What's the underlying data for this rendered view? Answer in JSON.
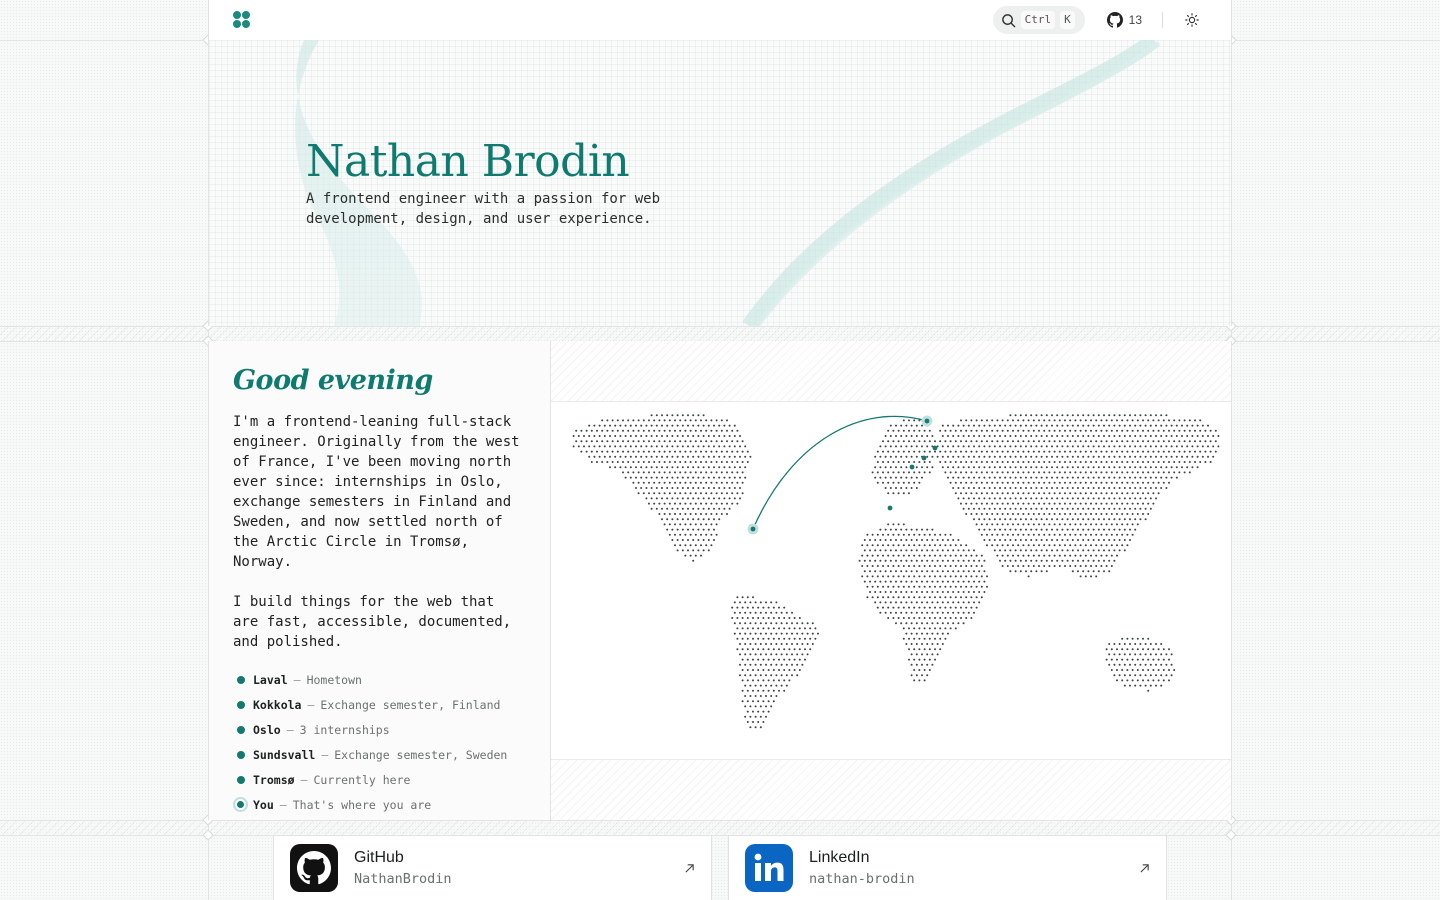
{
  "header": {
    "search_keys": [
      "Ctrl",
      "K"
    ],
    "github_stars": "13"
  },
  "hero": {
    "name": "Nathan Brodin",
    "tagline": "A frontend engineer with a passion for web development, design, and user experience."
  },
  "about": {
    "greeting": "Good evening",
    "bio": [
      "I'm a frontend-leaning full-stack engineer. Originally from the west of France, I've been moving north ever since: internships in Oslo, exchange semesters in Finland and Sweden, and now settled north of the Arctic Circle in Tromsø, Norway.",
      "I build things for the web that are fast, accessible, documented, and polished."
    ],
    "places": [
      {
        "name": "Laval",
        "desc": "Hometown"
      },
      {
        "name": "Kokkola",
        "desc": "Exchange semester, Finland"
      },
      {
        "name": "Oslo",
        "desc": "3 internships"
      },
      {
        "name": "Sundsvall",
        "desc": "Exchange semester, Sweden"
      },
      {
        "name": "Tromsø",
        "desc": "Currently here"
      },
      {
        "name": "You",
        "desc": "That's where you are"
      }
    ],
    "separator": "—"
  },
  "social": [
    {
      "title": "GitHub",
      "handle": "NathanBrodin",
      "icon": "github-icon",
      "color": "#111111"
    },
    {
      "title": "LinkedIn",
      "handle": "nathan-brodin",
      "icon": "linkedin-icon",
      "color": "#0a66c2"
    }
  ],
  "colors": {
    "accent": "#0f7a6f",
    "dot": "#147a6f"
  }
}
